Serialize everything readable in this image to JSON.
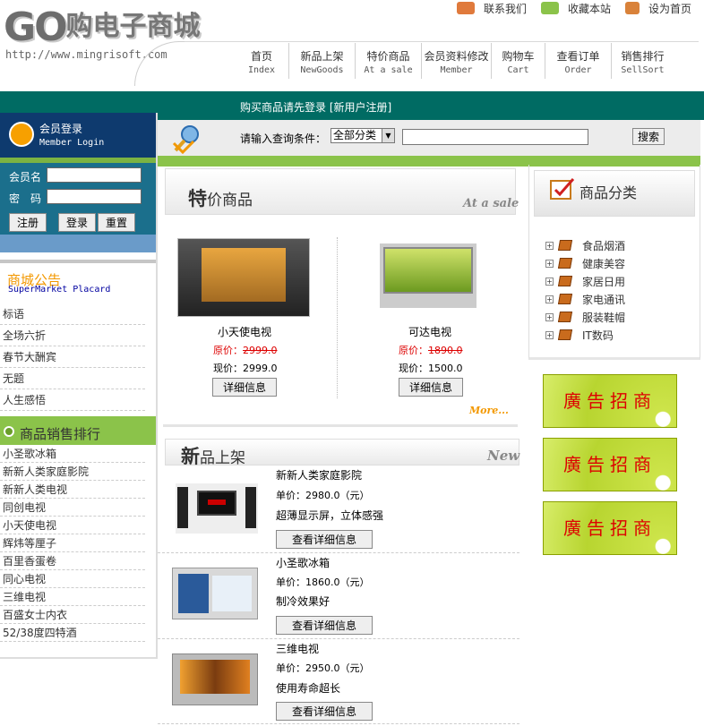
{
  "header": {
    "logo_latin": "GO",
    "logo_cn": "购电子商城",
    "url": "http://www.mingrisoft.com",
    "top_links": [
      "联系我们",
      "收藏本站",
      "设为首页"
    ],
    "nav": [
      {
        "cn": "首页",
        "en": "Index"
      },
      {
        "cn": "新品上架",
        "en": "NewGoods"
      },
      {
        "cn": "特价商品",
        "en": "At a sale"
      },
      {
        "cn": "会员资料修改",
        "en": "Member"
      },
      {
        "cn": "购物车",
        "en": "Cart"
      },
      {
        "cn": "查看订单",
        "en": "Order"
      },
      {
        "cn": "销售排行",
        "en": "SellSort"
      }
    ],
    "login_prompt": "购买商品请先登录 [新用户注册]"
  },
  "member": {
    "title": "会员登录",
    "subtitle": "Member Login",
    "username_label": "会员名",
    "password_label": "密　码",
    "register": "注册",
    "login": "登录",
    "reset": "重置"
  },
  "notice": {
    "title": "商城公告",
    "subtitle": "SuperMarket Placard",
    "items": [
      "标语",
      "全场六折",
      "春节大酬宾",
      "无题",
      "人生感悟"
    ]
  },
  "ranking": {
    "title": "商品销售排行",
    "items": [
      "小圣歌冰箱",
      "新新人类家庭影院",
      "新新人类电视",
      "同创电视",
      "小天使电视",
      "辉炜等厘子",
      "百里香蛋卷",
      "同心电视",
      "三维电视",
      "百盛女士内衣",
      "52/38度四特酒"
    ]
  },
  "search": {
    "label": "请输入查询条件：",
    "category": "全部分类",
    "button": "搜索"
  },
  "special": {
    "title_big": "特",
    "title_rest": "价商品",
    "title_en": "At a sale",
    "products": [
      {
        "name": "小天使电视",
        "old_label": "原价：",
        "old_price": "2999.0",
        "now_label": "现价：",
        "now_price": "2999.0",
        "detail": "详细信息"
      },
      {
        "name": "可达电视",
        "old_label": "原价：",
        "old_price": "1890.0",
        "now_label": "现价：",
        "now_price": "1500.0",
        "detail": "详细信息"
      }
    ],
    "more": "More..."
  },
  "newgoods": {
    "title_big": "新",
    "title_rest": "品上架",
    "title_en": "New",
    "items": [
      {
        "name": "新新人类家庭影院",
        "price": "单价：2980.0（元）",
        "desc": "超薄显示屏，立体感强",
        "button": "查看详细信息"
      },
      {
        "name": "小圣歌冰箱",
        "price": "单价：1860.0（元）",
        "desc": "制冷效果好",
        "button": "查看详细信息"
      },
      {
        "name": "三维电视",
        "price": "单价：2950.0（元）",
        "desc": "使用寿命超长",
        "button": "查看详细信息"
      }
    ]
  },
  "category": {
    "title": "商品分类",
    "items": [
      "食品烟酒",
      "健康美容",
      "家居日用",
      "家电通讯",
      "服装鞋帽",
      "IT数码"
    ]
  },
  "ads": [
    "廣告招商",
    "廣告招商",
    "廣告招商"
  ],
  "colors": {
    "teal": "#006b63",
    "navy": "#0e3a6e",
    "green": "#8bc34a",
    "orange": "#f39800"
  }
}
